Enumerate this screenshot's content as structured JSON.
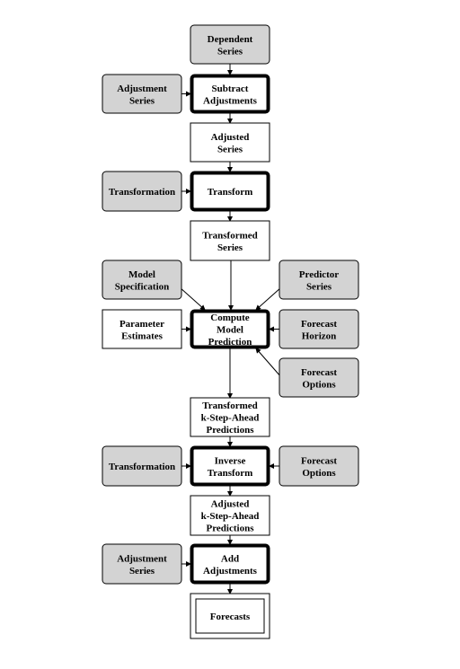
{
  "diagram": {
    "nodes": [
      {
        "id": "dependent-series",
        "lines": [
          "Dependent",
          "Series"
        ],
        "style": "input"
      },
      {
        "id": "adjustment-series-1",
        "lines": [
          "Adjustment",
          "Series"
        ],
        "style": "input"
      },
      {
        "id": "subtract-adjustments",
        "lines": [
          "Subtract",
          "Adjustments"
        ],
        "style": "process"
      },
      {
        "id": "adjusted-series",
        "lines": [
          "Adjusted",
          "Series"
        ],
        "style": "data"
      },
      {
        "id": "transformation-1",
        "lines": [
          "Transformation"
        ],
        "style": "input"
      },
      {
        "id": "transform",
        "lines": [
          "Transform"
        ],
        "style": "process"
      },
      {
        "id": "transformed-series",
        "lines": [
          "Transformed",
          "Series"
        ],
        "style": "data"
      },
      {
        "id": "model-specification",
        "lines": [
          "Model",
          "Specification"
        ],
        "style": "input"
      },
      {
        "id": "predictor-series",
        "lines": [
          "Predictor",
          "Series"
        ],
        "style": "input"
      },
      {
        "id": "parameter-estimates",
        "lines": [
          "Parameter",
          "Estimates"
        ],
        "style": "data"
      },
      {
        "id": "compute-model-prediction",
        "lines": [
          "Compute",
          "Model",
          "Prediction"
        ],
        "style": "process"
      },
      {
        "id": "forecast-horizon",
        "lines": [
          "Forecast",
          "Horizon"
        ],
        "style": "input"
      },
      {
        "id": "forecast-options-1",
        "lines": [
          "Forecast",
          "Options"
        ],
        "style": "input"
      },
      {
        "id": "transformed-predictions",
        "lines": [
          "Transformed",
          "k-Step-Ahead",
          "Predictions"
        ],
        "style": "data"
      },
      {
        "id": "transformation-2",
        "lines": [
          "Transformation"
        ],
        "style": "input"
      },
      {
        "id": "inverse-transform",
        "lines": [
          "Inverse",
          "Transform"
        ],
        "style": "process"
      },
      {
        "id": "forecast-options-2",
        "lines": [
          "Forecast",
          "Options"
        ],
        "style": "input"
      },
      {
        "id": "adjusted-predictions",
        "lines": [
          "Adjusted",
          "k-Step-Ahead",
          "Predictions"
        ],
        "style": "data"
      },
      {
        "id": "adjustment-series-2",
        "lines": [
          "Adjustment",
          "Series"
        ],
        "style": "input"
      },
      {
        "id": "add-adjustments",
        "lines": [
          "Add",
          "Adjustments"
        ],
        "style": "process"
      },
      {
        "id": "forecasts",
        "lines": [
          "Forecasts"
        ],
        "style": "output"
      }
    ],
    "edges": [
      {
        "from": "dependent-series",
        "to": "subtract-adjustments"
      },
      {
        "from": "adjustment-series-1",
        "to": "subtract-adjustments"
      },
      {
        "from": "subtract-adjustments",
        "to": "adjusted-series"
      },
      {
        "from": "adjusted-series",
        "to": "transform"
      },
      {
        "from": "transformation-1",
        "to": "transform"
      },
      {
        "from": "transform",
        "to": "transformed-series"
      },
      {
        "from": "transformed-series",
        "to": "compute-model-prediction"
      },
      {
        "from": "model-specification",
        "to": "compute-model-prediction"
      },
      {
        "from": "predictor-series",
        "to": "compute-model-prediction"
      },
      {
        "from": "parameter-estimates",
        "to": "compute-model-prediction"
      },
      {
        "from": "forecast-horizon",
        "to": "compute-model-prediction"
      },
      {
        "from": "forecast-options-1",
        "to": "compute-model-prediction"
      },
      {
        "from": "compute-model-prediction",
        "to": "transformed-predictions"
      },
      {
        "from": "transformed-predictions",
        "to": "inverse-transform"
      },
      {
        "from": "transformation-2",
        "to": "inverse-transform"
      },
      {
        "from": "forecast-options-2",
        "to": "inverse-transform"
      },
      {
        "from": "inverse-transform",
        "to": "adjusted-predictions"
      },
      {
        "from": "adjusted-predictions",
        "to": "add-adjustments"
      },
      {
        "from": "adjustment-series-2",
        "to": "add-adjustments"
      },
      {
        "from": "add-adjustments",
        "to": "forecasts"
      }
    ],
    "colors": {
      "input_fill": "#d3d3d3",
      "data_fill": "#ffffff",
      "stroke": "#000000"
    }
  }
}
